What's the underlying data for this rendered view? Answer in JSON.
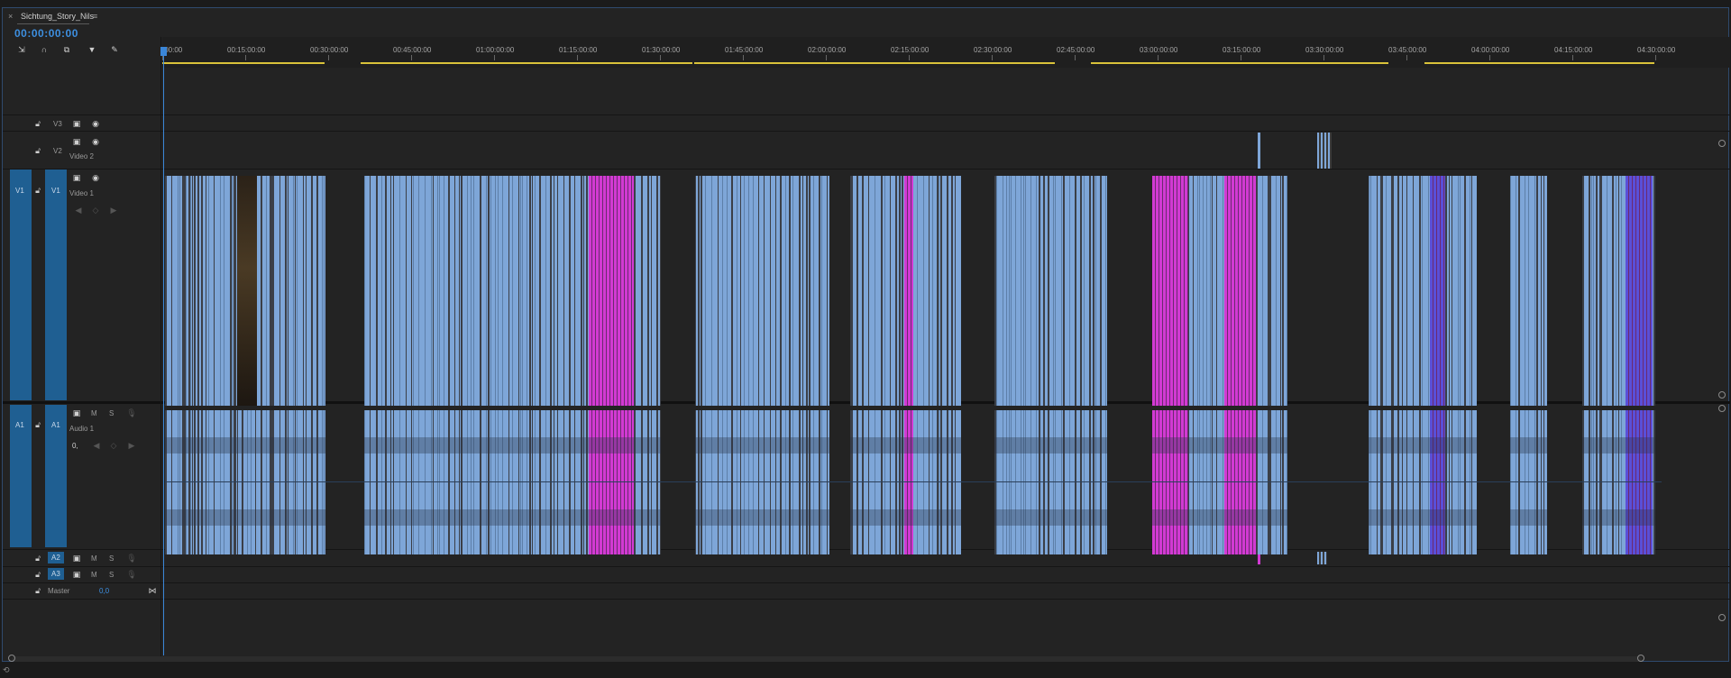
{
  "panel": {
    "close_glyph": "×",
    "title": "Sichtung_Story_Nils",
    "menu_glyph": "≡",
    "timecode": "00:00:00:00"
  },
  "toolbar": {
    "icons": [
      "insert-overwrite-icon",
      "snap-icon",
      "linked-selection-icon",
      "add-marker-icon",
      "settings-wrench-icon"
    ]
  },
  "ruler": {
    "ticks": [
      ":00:00",
      "00:15:00:00",
      "00:30:00:00",
      "00:45:00:00",
      "01:00:00:00",
      "01:15:00:00",
      "01:30:00:00",
      "01:45:00:00",
      "02:00:00:00",
      "02:15:00:00",
      "02:30:00:00",
      "02:45:00:00",
      "03:00:00:00",
      "03:15:00:00",
      "03:30:00:00",
      "03:45:00:00",
      "04:00:00:00",
      "04:15:00:00",
      "04:30:00:00"
    ]
  },
  "tracks": {
    "v3": {
      "label": "V3"
    },
    "v2": {
      "label": "V2",
      "name": "Video 2"
    },
    "v1": {
      "source": "V1",
      "label": "V1",
      "name": "Video 1"
    },
    "a1": {
      "source": "A1",
      "label": "A1",
      "name": "Audio 1",
      "volume": "0,"
    },
    "a2": {
      "label": "A2"
    },
    "a3": {
      "label": "A3"
    },
    "master": {
      "name": "Master",
      "value": "0,0"
    },
    "mute": "M",
    "solo": "S"
  },
  "colors": {
    "clip_blue": "#7ea6d8",
    "clip_magenta": "#d23ad3",
    "clip_violet": "#5a4fd8",
    "track_target_blue": "#1f5f92",
    "playhead_blue": "#3a86d8",
    "workarea_yellow": "#d9c23a"
  }
}
